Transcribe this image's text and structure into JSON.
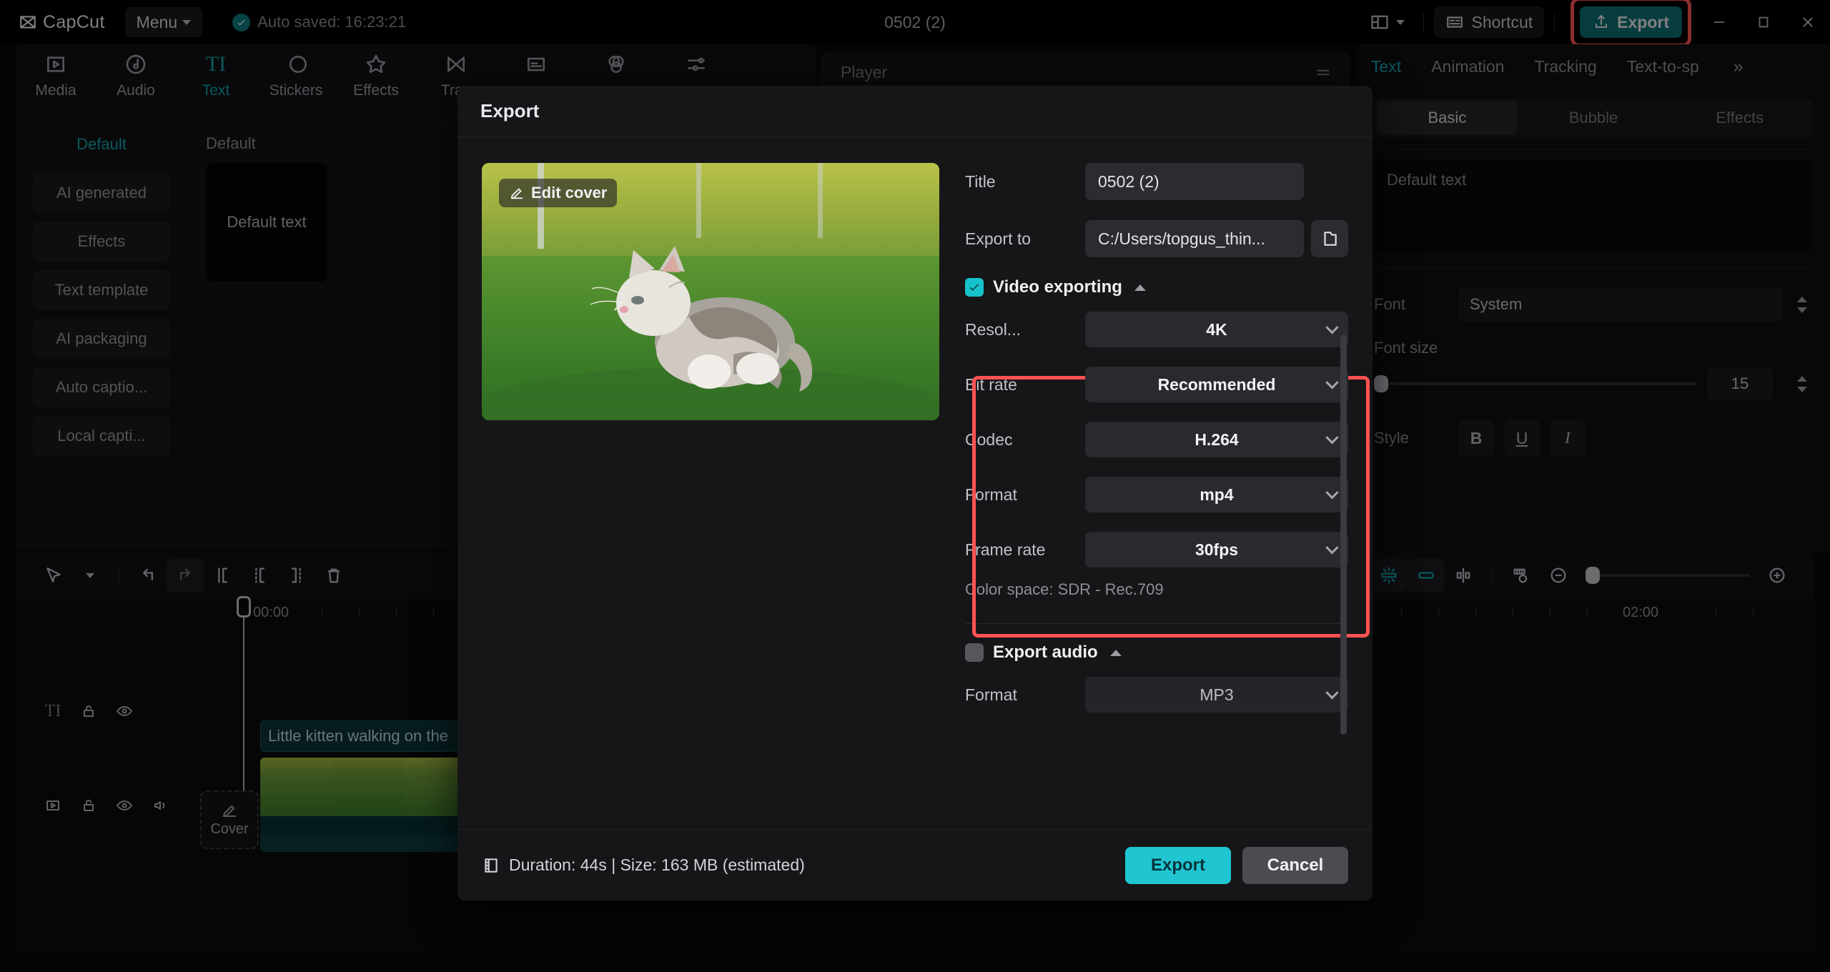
{
  "titlebar": {
    "brand": "CapCut",
    "menu_label": "Menu",
    "autosave_text": "Auto saved: 16:23:21",
    "project_title": "0502 (2)",
    "shortcut_label": "Shortcut",
    "export_label": "Export",
    "icons": {
      "logo": "capcut-logo-icon",
      "autosave_check": "check-circle-icon",
      "layout": "layout-grid-icon",
      "layout_caret": "chevron-down-icon",
      "shortcut": "keyboard-icon",
      "export": "share-upload-icon",
      "minimize": "minimize-icon",
      "maximize": "maximize-icon",
      "close": "close-icon"
    },
    "highlight_color": "#ff5252",
    "export_bg": "#0e6e73"
  },
  "nav_tabs": [
    {
      "label": "Media",
      "icon": "media-play-icon",
      "active": false
    },
    {
      "label": "Audio",
      "icon": "audio-note-icon",
      "active": false
    },
    {
      "label": "Text",
      "icon": "text-ti-icon",
      "active": true
    },
    {
      "label": "Stickers",
      "icon": "sticker-icon",
      "active": false
    },
    {
      "label": "Effects",
      "icon": "effects-star-icon",
      "active": false
    },
    {
      "label": "Tran",
      "icon": "transition-icon",
      "active": false
    },
    {
      "label": "",
      "icon": "captions-icon",
      "active": false
    },
    {
      "label": "",
      "icon": "filters-icon",
      "active": false
    },
    {
      "label": "",
      "icon": "adjustment-icon",
      "active": false
    }
  ],
  "left_panel": {
    "items": [
      {
        "label": "Default",
        "selected": true
      },
      {
        "label": "AI generated",
        "selected": false
      },
      {
        "label": "Effects",
        "selected": false
      },
      {
        "label": "Text template",
        "selected": false
      },
      {
        "label": "AI packaging",
        "selected": false
      },
      {
        "label": "Auto captio...",
        "selected": false
      },
      {
        "label": "Local capti...",
        "selected": false
      }
    ],
    "content_title": "Default",
    "content_card_label": "Default text"
  },
  "player": {
    "title": "Player",
    "menu_icon": "hamburger-icon"
  },
  "right_panel": {
    "tabs": [
      {
        "label": "Text",
        "active": true
      },
      {
        "label": "Animation",
        "active": false
      },
      {
        "label": "Tracking",
        "active": false
      },
      {
        "label": "Text-to-sp",
        "active": false
      }
    ],
    "more_icon": "chevrons-right-icon",
    "segments": [
      {
        "label": "Basic",
        "active": true
      },
      {
        "label": "Bubble",
        "active": false
      },
      {
        "label": "Effects",
        "active": false
      }
    ],
    "text_value": "Default text",
    "font_label": "Font",
    "font_value": "System",
    "font_size_label": "Font size",
    "font_size_value": "15",
    "style_label": "Style",
    "style_buttons": [
      {
        "glyph": "B",
        "name": "bold-button"
      },
      {
        "glyph": "U",
        "name": "underline-button"
      },
      {
        "glyph": "I",
        "name": "italic-button"
      }
    ]
  },
  "timeline": {
    "toolbar_left_icons": [
      "select-arrow-icon",
      "chevron-down-icon",
      "undo-icon",
      "redo-icon",
      "split-icon",
      "trim-start-icon",
      "trim-end-icon",
      "delete-trash-icon"
    ],
    "toolbar_right_icons": [
      "magic-cut-icon",
      "link-clip-icon",
      "mirror-icon",
      "auto-fit-icon",
      "zoom-out-icon",
      "zoom-in-icon"
    ],
    "ruler_labels": [
      "00:00",
      "02:00"
    ],
    "cover_button_label": "Cover",
    "text_clip_label": "Little kitten walking on the",
    "track_head_icons_text": [
      "text-ti-icon",
      "lock-icon",
      "eye-icon"
    ],
    "track_head_icons_video": [
      "video-icon",
      "lock-icon",
      "eye-icon",
      "volume-icon"
    ]
  },
  "dialog": {
    "title": "Export",
    "edit_cover_label": "Edit cover",
    "edit_cover_icon": "pencil-icon",
    "fields": [
      {
        "label": "Title",
        "value": "0502 (2)",
        "name": "title-field"
      },
      {
        "label": "Export to",
        "value": "C:/Users/topgus_thin...",
        "name": "export-path-field"
      }
    ],
    "folder_icon": "folder-icon",
    "video_section": {
      "title": "Video exporting",
      "checked": true,
      "checkbox_color": "#16c3cc",
      "options": [
        {
          "label": "Resol...",
          "value": "4K",
          "name": "resolution-select"
        },
        {
          "label": "Bit rate",
          "value": "Recommended",
          "name": "bitrate-select"
        },
        {
          "label": "Codec",
          "value": "H.264",
          "name": "codec-select"
        },
        {
          "label": "Format",
          "value": "mp4",
          "name": "video-format-select"
        },
        {
          "label": "Frame rate",
          "value": "30fps",
          "name": "framerate-select"
        }
      ],
      "color_space": "Color space: SDR - Rec.709",
      "highlight_color": "#ff5252"
    },
    "audio_section": {
      "title": "Export audio",
      "checked": false,
      "options": [
        {
          "label": "Format",
          "value": "MP3",
          "name": "audio-format-select"
        }
      ]
    },
    "footer": {
      "info": "Duration: 44s | Size: 163 MB (estimated)",
      "info_icon": "film-icon",
      "export_label": "Export",
      "cancel_label": "Cancel",
      "export_color": "#1fc6d2"
    }
  }
}
